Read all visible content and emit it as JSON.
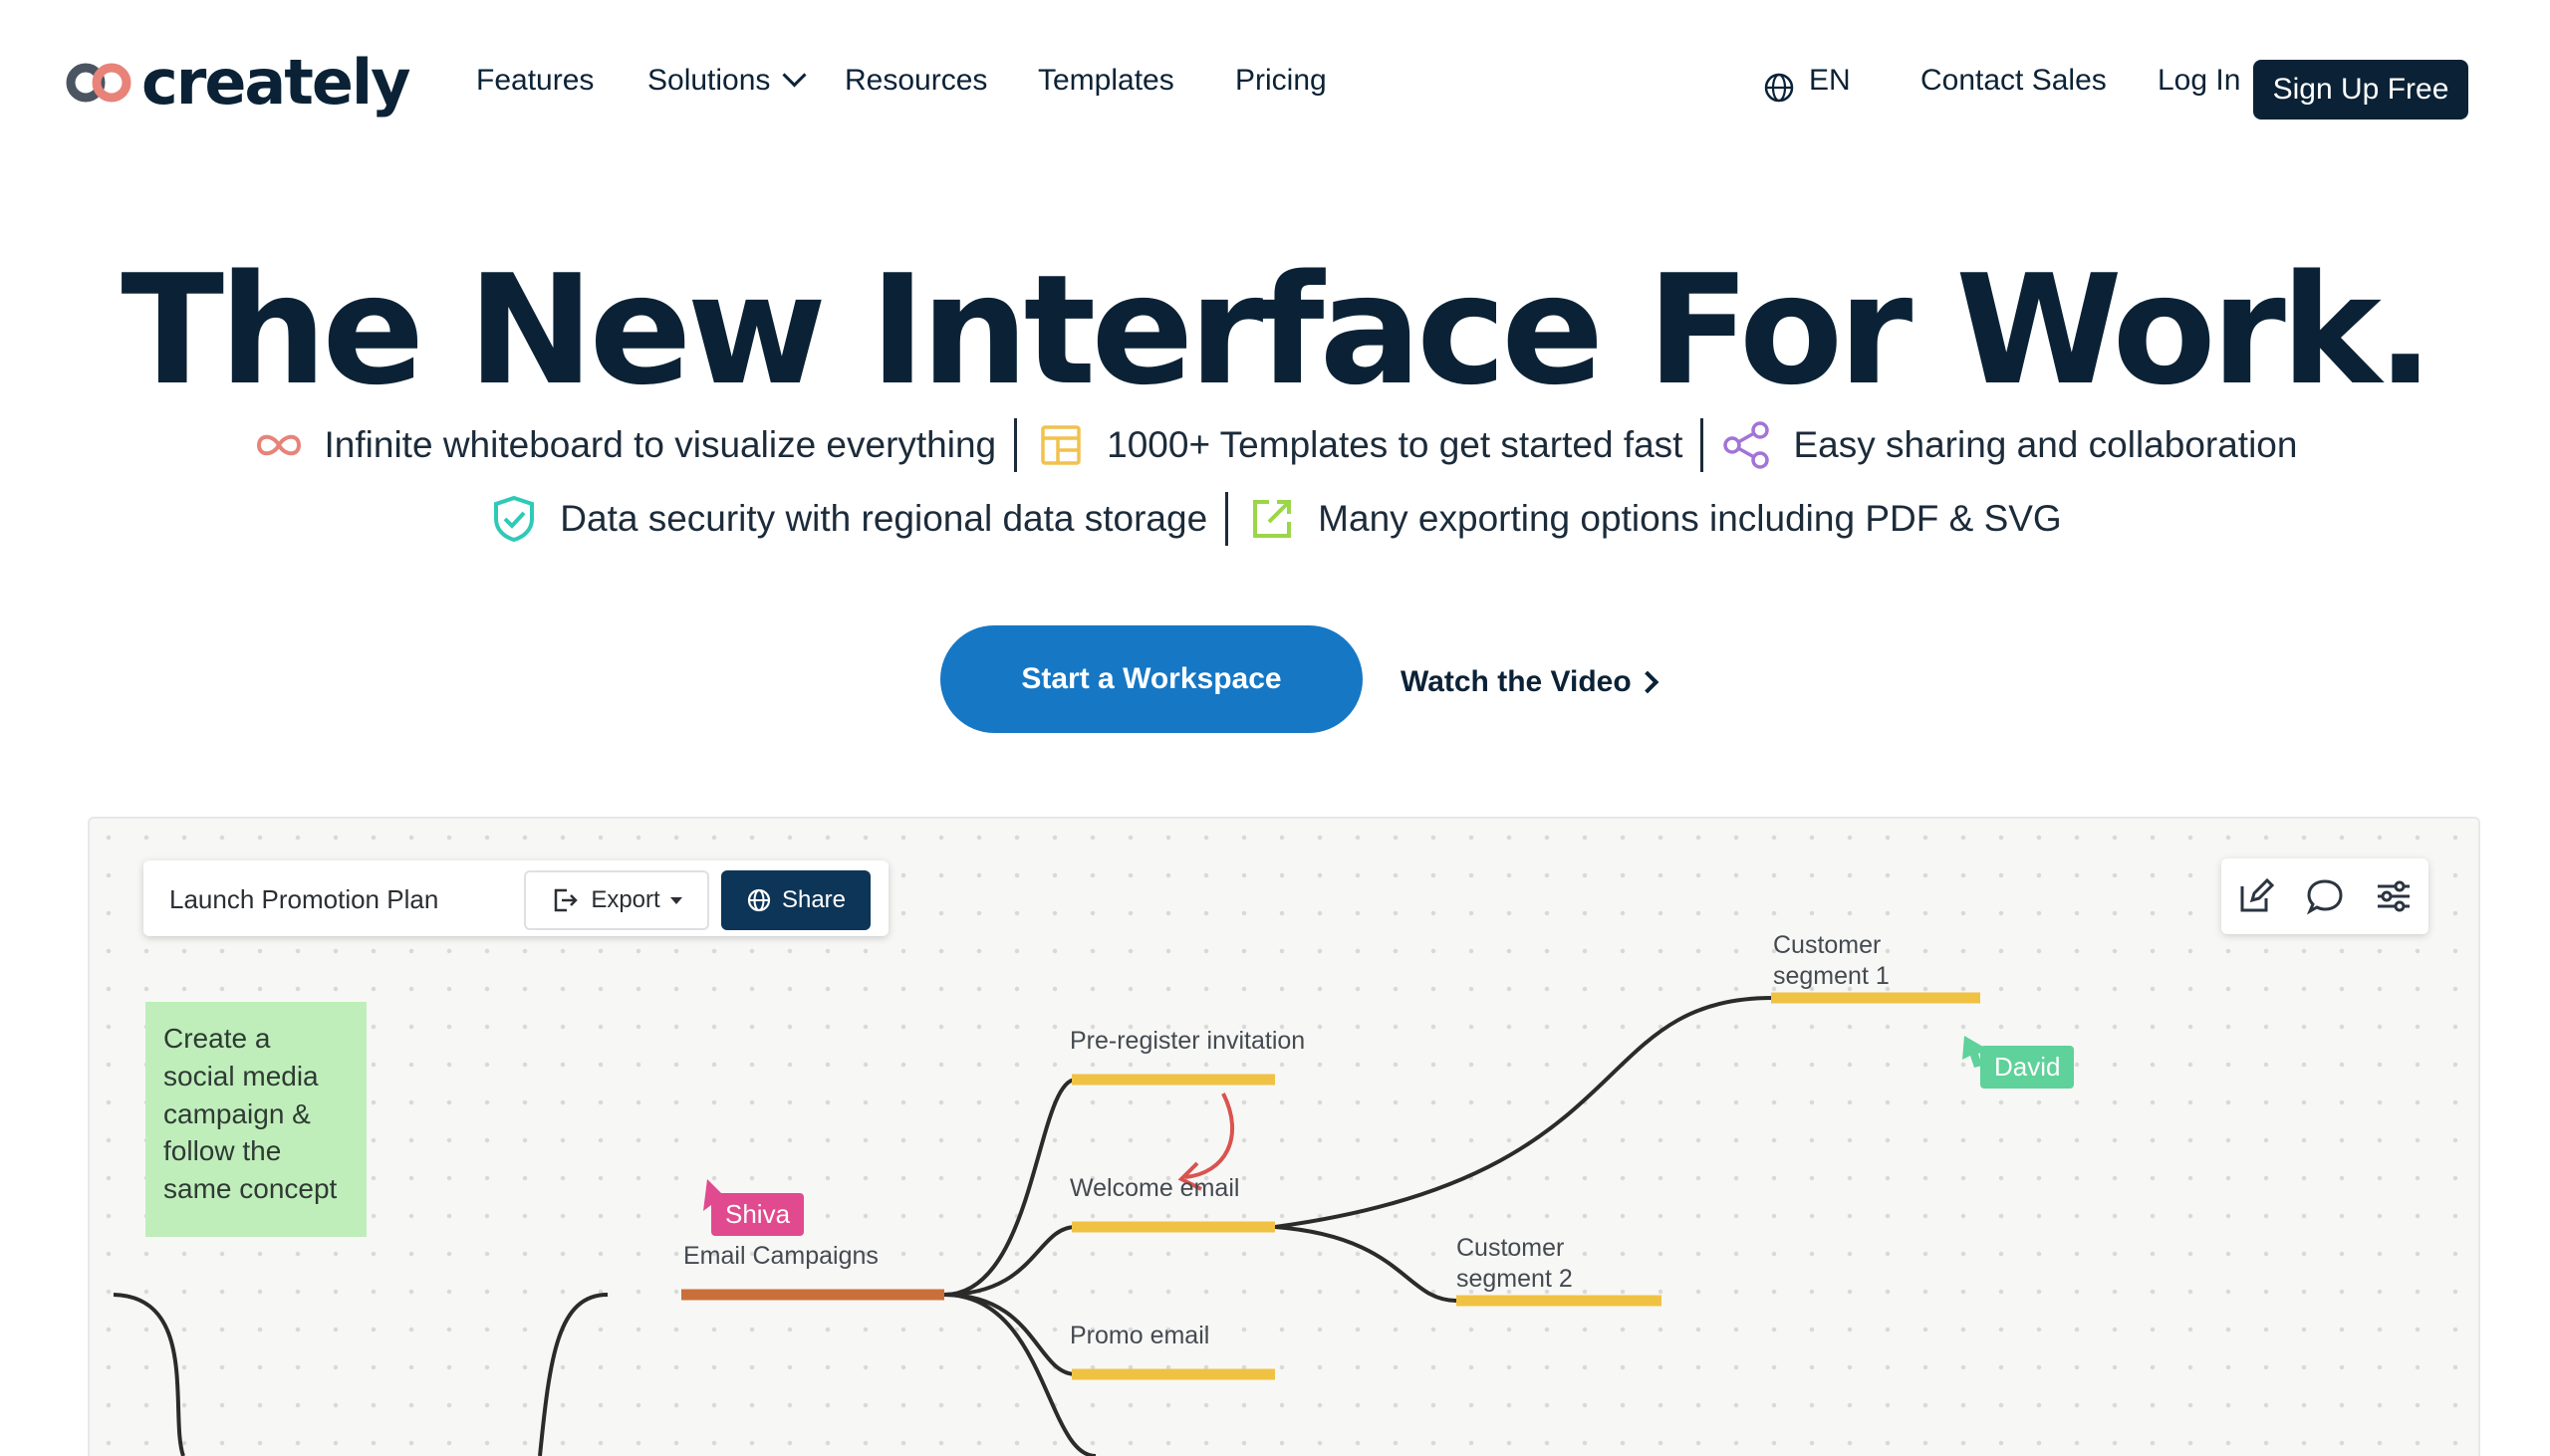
{
  "brand": {
    "name": "creately"
  },
  "nav": {
    "links": [
      "Features",
      "Solutions",
      "Resources",
      "Templates",
      "Pricing"
    ],
    "lang": "EN",
    "contact": "Contact Sales",
    "login": "Log In",
    "signup": "Sign Up Free"
  },
  "hero": {
    "title": "The New Interface For Work.",
    "features": [
      {
        "icon": "infinity-icon",
        "text": "Infinite whiteboard to visualize everything"
      },
      {
        "icon": "templates-icon",
        "text": "1000+ Templates to get started fast"
      },
      {
        "icon": "share-nodes-icon",
        "text": "Easy sharing and collaboration"
      },
      {
        "icon": "shield-check-icon",
        "text": "Data security with regional data storage"
      },
      {
        "icon": "export-icon",
        "text": "Many exporting options including PDF & SVG"
      }
    ],
    "cta": "Start a Workspace",
    "watch": "Watch the Video"
  },
  "preview": {
    "doc_title": "Launch Promotion Plan",
    "export_label": "Export",
    "share_label": "Share",
    "sticky_note": "Create a social media campaign & follow the same concept",
    "nodes": {
      "email_campaigns": "Email Campaigns",
      "pre_register": "Pre-register invitation",
      "welcome": "Welcome email",
      "promo": "Promo email",
      "segment1_line1": "Customer",
      "segment1_line2": "segment 1",
      "segment2_line1": "Customer",
      "segment2_line2": "segment 2"
    },
    "cursors": {
      "shiva": "Shiva",
      "david": "David"
    }
  },
  "colors": {
    "navy": "#0b2236",
    "cta_blue": "#1677c4",
    "share_navy": "#0d3557",
    "branch_orange": "#c9703a",
    "branch_yellow": "#f0c243",
    "sticky_green": "#bfeebb",
    "shiva_pink": "#e14a8e",
    "david_green": "#5fd19a"
  }
}
